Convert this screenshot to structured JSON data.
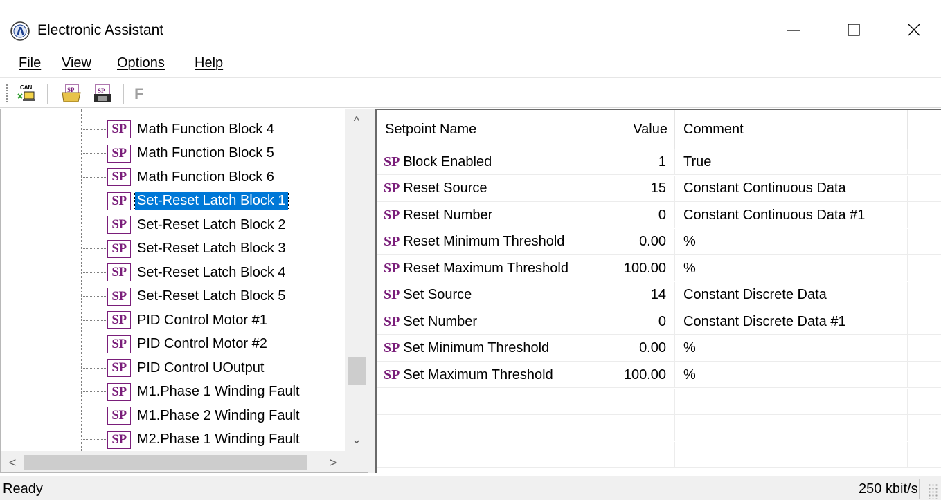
{
  "window": {
    "title": "Electronic Assistant",
    "icon": "ea-logo-icon",
    "controls": [
      "minimize-icon",
      "maximize-icon",
      "close-icon"
    ]
  },
  "menu": {
    "items": [
      {
        "label": "File"
      },
      {
        "label": "View"
      },
      {
        "label": "Options"
      },
      {
        "label": "Help"
      }
    ]
  },
  "toolbar": {
    "can_icon_text": "CAN",
    "open_sp_icon_text": "SP",
    "save_sp_icon_text": "SP",
    "flash_label": "F"
  },
  "tree": {
    "icon_text": "SP",
    "selected_index": 3,
    "items": [
      {
        "label": "Math Function Block 4"
      },
      {
        "label": "Math Function Block 5"
      },
      {
        "label": "Math Function Block 6"
      },
      {
        "label": "Set-Reset Latch Block 1"
      },
      {
        "label": "Set-Reset Latch Block 2"
      },
      {
        "label": "Set-Reset Latch Block 3"
      },
      {
        "label": "Set-Reset Latch Block 4"
      },
      {
        "label": "Set-Reset Latch Block 5"
      },
      {
        "label": "PID Control Motor #1"
      },
      {
        "label": "PID Control Motor #2"
      },
      {
        "label": "PID Control UOutput"
      },
      {
        "label": "M1.Phase 1 Winding Fault"
      },
      {
        "label": "M1.Phase 2 Winding Fault"
      },
      {
        "label": "M2.Phase 1 Winding Fault"
      }
    ]
  },
  "setpoints": {
    "columns": {
      "name": "Setpoint Name",
      "value": "Value",
      "comment": "Comment"
    },
    "sp_prefix": "SP",
    "rows": [
      {
        "name": "Block Enabled",
        "value": "1",
        "comment": "True"
      },
      {
        "name": "Reset Source",
        "value": "15",
        "comment": "Constant Continuous Data"
      },
      {
        "name": "Reset Number",
        "value": "0",
        "comment": "Constant Continuous Data #1"
      },
      {
        "name": "Reset Minimum Threshold",
        "value": "0.00",
        "comment": "%"
      },
      {
        "name": "Reset Maximum Threshold",
        "value": "100.00",
        "comment": "%"
      },
      {
        "name": "Set Source",
        "value": "14",
        "comment": "Constant Discrete Data"
      },
      {
        "name": "Set Number",
        "value": "0",
        "comment": "Constant Discrete Data #1"
      },
      {
        "name": "Set Minimum Threshold",
        "value": "0.00",
        "comment": "%"
      },
      {
        "name": "Set Maximum Threshold",
        "value": "100.00",
        "comment": "%"
      }
    ]
  },
  "status": {
    "left": "Ready",
    "right": "250 kbit/s"
  },
  "colors": {
    "sp_purple": "#7a1e7a",
    "selection_blue": "#0078d7"
  }
}
